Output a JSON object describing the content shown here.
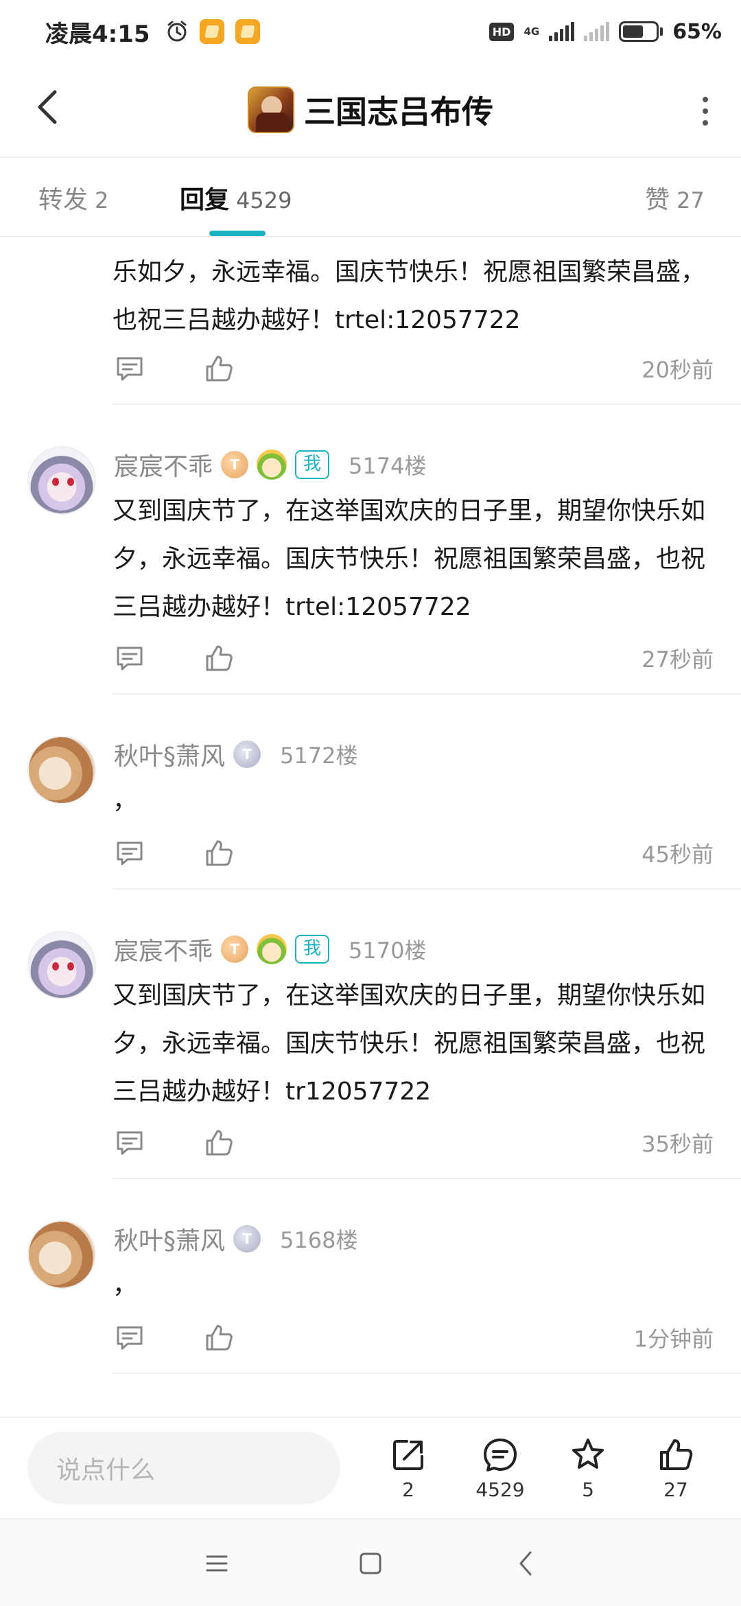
{
  "status_bar": {
    "time": "凌晨4:15",
    "hd": "HD",
    "network": "4G",
    "battery": "65%",
    "icons": [
      "alarm-icon",
      "notification-icon",
      "notification-icon",
      "signal-icon",
      "signal-icon",
      "battery-icon"
    ]
  },
  "header": {
    "title": "三国志吕布传",
    "icons": [
      "back-arrow-icon",
      "app-logo",
      "more-vertical-icon"
    ]
  },
  "tabs": [
    {
      "label": "转发",
      "count": "2",
      "active": false
    },
    {
      "label": "回复",
      "count": "4529",
      "active": true
    },
    {
      "label": "赞",
      "count": "27",
      "active": false
    }
  ],
  "accent_color": "#1ab3c1",
  "posts": [
    {
      "user": "",
      "floor": "",
      "body": "乐如夕，永远幸福。国庆节快乐！祝愿祖国繁荣昌盛，也祝三吕越办越好！trtel:12057722",
      "time": "20秒前"
    },
    {
      "user": "宸宸不乖",
      "badges": [
        "coin-t1",
        "character",
        "me"
      ],
      "me_label": "我",
      "floor": "5174楼",
      "body": "又到国庆节了，在这举国欢庆的日子里，期望你快乐如夕，永远幸福。国庆节快乐！祝愿祖国繁荣昌盛，也祝三吕越办越好！trtel:12057722",
      "time": "27秒前"
    },
    {
      "user": "秋叶§萧风",
      "badges": [
        "coin-t2"
      ],
      "floor": "5172楼",
      "body": "，",
      "time": "45秒前"
    },
    {
      "user": "宸宸不乖",
      "badges": [
        "coin-t1",
        "character",
        "me"
      ],
      "me_label": "我",
      "floor": "5170楼",
      "body": "又到国庆节了，在这举国欢庆的日子里，期望你快乐如夕，永远幸福。国庆节快乐！祝愿祖国繁荣昌盛，也祝三吕越办越好！tr12057722",
      "time": "35秒前"
    },
    {
      "user": "秋叶§萧风",
      "badges": [
        "coin-t2"
      ],
      "floor": "5168楼",
      "body": "，",
      "time": "1分钟前"
    }
  ],
  "bottom_bar": {
    "placeholder": "说点什么",
    "share_count": "2",
    "comment_count": "4529",
    "favorite_count": "5",
    "like_count": "27"
  },
  "nav_bar": {
    "icons": [
      "menu-icon",
      "home-icon",
      "back-icon"
    ]
  }
}
